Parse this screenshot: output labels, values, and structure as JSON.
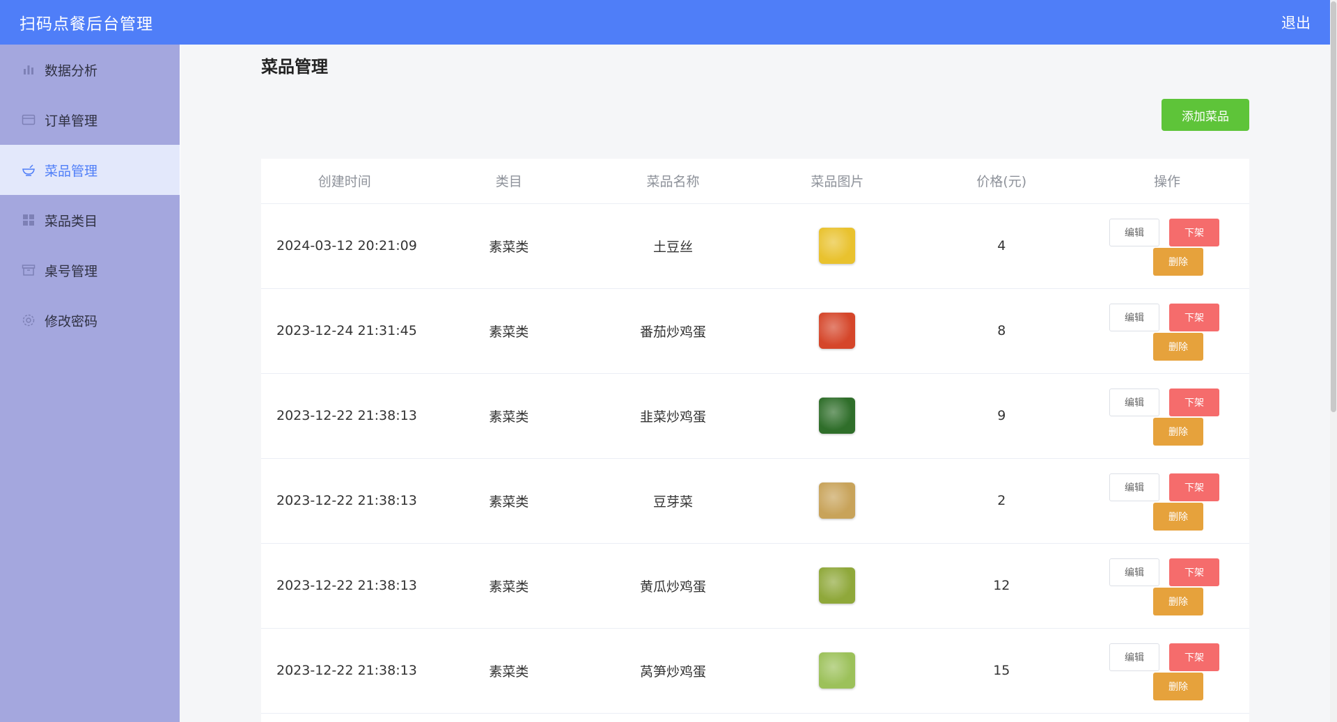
{
  "header": {
    "title": "扫码点餐后台管理",
    "logout_label": "退出"
  },
  "sidebar": {
    "items": [
      {
        "label": "数据分析",
        "icon": "bar-chart-icon"
      },
      {
        "label": "订单管理",
        "icon": "card-icon"
      },
      {
        "label": "菜品管理",
        "icon": "bowl-icon",
        "active": true
      },
      {
        "label": "菜品类目",
        "icon": "grid-icon"
      },
      {
        "label": "桌号管理",
        "icon": "box-icon"
      },
      {
        "label": "修改密码",
        "icon": "gear-icon"
      }
    ]
  },
  "main": {
    "title": "菜品管理",
    "add_label": "添加菜品",
    "table": {
      "columns": [
        "创建时间",
        "类目",
        "菜品名称",
        "菜品图片",
        "价格(元)",
        "操作"
      ],
      "rows": [
        {
          "time": "2024-03-12 20:21:09",
          "category": "素菜类",
          "name": "土豆丝",
          "price": "4",
          "image_color": "#e9c22e"
        },
        {
          "time": "2023-12-24 21:31:45",
          "category": "素菜类",
          "name": "番茄炒鸡蛋",
          "price": "8",
          "image_color": "#d5462a"
        },
        {
          "time": "2023-12-22 21:38:13",
          "category": "素菜类",
          "name": "韭菜炒鸡蛋",
          "price": "9",
          "image_color": "#2f6e2a"
        },
        {
          "time": "2023-12-22 21:38:13",
          "category": "素菜类",
          "name": "豆芽菜",
          "price": "2",
          "image_color": "#c8a35a"
        },
        {
          "time": "2023-12-22 21:38:13",
          "category": "素菜类",
          "name": "黄瓜炒鸡蛋",
          "price": "12",
          "image_color": "#8fa83a"
        },
        {
          "time": "2023-12-22 21:38:13",
          "category": "素菜类",
          "name": "莴笋炒鸡蛋",
          "price": "15",
          "image_color": "#9cc15a"
        }
      ],
      "actions": {
        "edit": "编辑",
        "off": "下架",
        "delete": "删除"
      }
    }
  },
  "colors": {
    "header_bg": "#4f7ef8",
    "sidebar_bg": "#a4a7de",
    "active_item_bg": "#e3e8fb",
    "add_button": "#5ec439",
    "off_button": "#f56c6c",
    "delete_button": "#e6a23c"
  }
}
